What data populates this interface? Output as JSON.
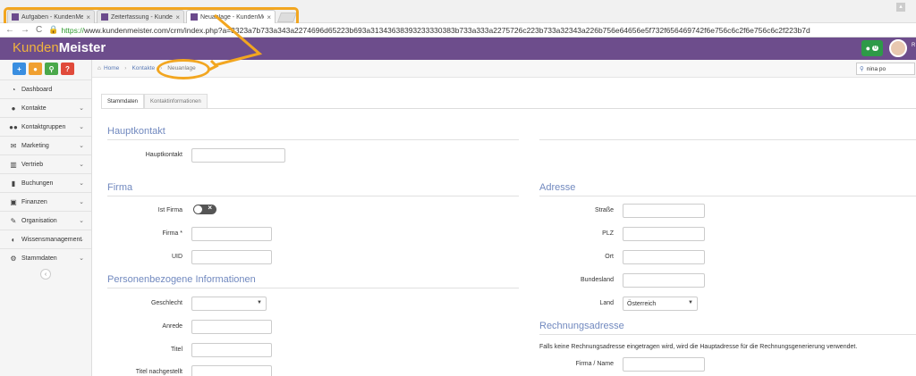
{
  "browser": {
    "tabs": [
      {
        "title": "Aufgaben - KundenMeis",
        "close": "×"
      },
      {
        "title": "Zeiterfassung - KundenMe",
        "close": "×"
      },
      {
        "title": "Neuanlage - KundenMeis",
        "close": "×"
      }
    ],
    "url_secure": "https://",
    "url": "www.kundenmeister.com/crm/index.php?a=3323a7b733a343a2274696d65223b693a31343638393233330383b733a333a2275726c223b733a32343a226b756e64656e5f732f656469742f6e756c6c2f6e756c6c2f223b7d"
  },
  "app": {
    "logo_light": "Kunden",
    "logo_bold": "Meister",
    "message_count": "0",
    "header_right": "R"
  },
  "quick_buttons": [
    {
      "icon": "plus-icon",
      "glyph": "+",
      "color": "#3a8ee0"
    },
    {
      "icon": "chat-icon",
      "glyph": "●",
      "color": "#f0a030"
    },
    {
      "icon": "search-icon",
      "glyph": "⚲",
      "color": "#4aa84a"
    },
    {
      "icon": "question-icon",
      "glyph": "?",
      "color": "#e04a3a"
    }
  ],
  "sidebar": {
    "items": [
      {
        "label": "Dashboard",
        "icon": "dashboard-icon",
        "glyph": "◔",
        "chevron": false
      },
      {
        "label": "Kontakte",
        "icon": "user-icon",
        "glyph": "●",
        "chevron": true
      },
      {
        "label": "Kontaktgruppen",
        "icon": "users-icon",
        "glyph": "●●",
        "chevron": true
      },
      {
        "label": "Marketing",
        "icon": "envelope-icon",
        "glyph": "✉",
        "chevron": true
      },
      {
        "label": "Vertrieb",
        "icon": "bar-chart-icon",
        "glyph": "▥",
        "chevron": true
      },
      {
        "label": "Buchungen",
        "icon": "bookmark-icon",
        "glyph": "▮",
        "chevron": true
      },
      {
        "label": "Finanzen",
        "icon": "money-icon",
        "glyph": "▣",
        "chevron": true
      },
      {
        "label": "Organisation",
        "icon": "edit-icon",
        "glyph": "✎",
        "chevron": true
      },
      {
        "label": "Wissensmanagement",
        "icon": "contrast-icon",
        "glyph": "◐",
        "chevron": true
      },
      {
        "label": "Stammdaten",
        "icon": "cogs-icon",
        "glyph": "⚙",
        "chevron": true
      }
    ],
    "collapse_glyph": "‹"
  },
  "breadcrumb": {
    "home": "Home",
    "kontakte": "Kontakte",
    "current": "Neuanlage"
  },
  "search": {
    "value": "nina po"
  },
  "content_tabs": [
    "Stammdaten",
    "Kontaktinformationen"
  ],
  "form": {
    "hauptkontakt_section": "Hauptkontakt",
    "hauptkontakt_label": "Hauptkontakt",
    "firma_section": "Firma",
    "ist_firma_label": "Ist Firma",
    "firma_label": "Firma *",
    "uid_label": "UID",
    "personen_section": "Personenbezogene Informationen",
    "geschlecht_label": "Geschlecht",
    "anrede_label": "Anrede",
    "titel_label": "Titel",
    "titel_nach_label": "Titel nachgestellt",
    "adresse_section": "Adresse",
    "strasse_label": "Straße",
    "plz_label": "PLZ",
    "ort_label": "Ort",
    "bundesland_label": "Bundesland",
    "land_label": "Land",
    "land_value": "Österreich",
    "rechnung_section": "Rechnungsadresse",
    "rechnung_note": "Falls keine Rechnungsadresse eingetragen wird, wird die Hauptadresse für die Rechnungsgenerierung verwendet.",
    "firma_name_label": "Firma / Name"
  }
}
